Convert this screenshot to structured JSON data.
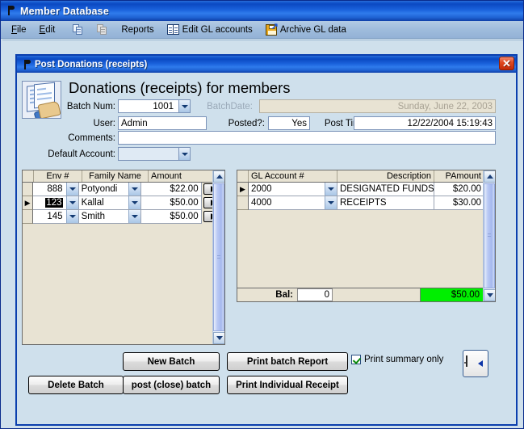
{
  "app": {
    "title": "Member Database",
    "menu": [
      {
        "label": "File",
        "accel": "F",
        "icon": "none"
      },
      {
        "label": "Edit",
        "accel": "E",
        "icon": "none"
      },
      {
        "label": "",
        "accel": "",
        "icon": "copy-icon"
      },
      {
        "label": "",
        "accel": "",
        "icon": "paste-icon"
      },
      {
        "label": "Reports",
        "accel": "",
        "icon": "none"
      },
      {
        "label": "Edit GL accounts",
        "accel": "",
        "icon": "book-icon"
      },
      {
        "label": "Archive GL data",
        "accel": "",
        "icon": "save-icon"
      }
    ]
  },
  "dialog": {
    "title": "Post Donations (receipts)",
    "close_label": "✕",
    "heading": "Donations (receipts) for members",
    "fields": {
      "batch_num_label": "Batch Num:",
      "batch_num_value": "1001",
      "batch_date_label": "BatchDate:",
      "batch_date_value": "Sunday, June 22, 2003",
      "user_label": "User:",
      "user_value": "Admin",
      "posted_label": "Posted?:",
      "posted_value": "Yes",
      "post_time_label": "Post Time",
      "post_time_value": "12/22/2004 15:19:43",
      "comments_label": "Comments:",
      "comments_value": "",
      "default_account_label": "Default Account:",
      "default_account_value": ""
    },
    "left_grid": {
      "columns": [
        "Env #",
        "Family Name",
        "Amount"
      ],
      "rows": [
        {
          "selector": "",
          "env": "888",
          "env_selected": false,
          "family": "Potyondi",
          "amount": "$22.00"
        },
        {
          "selector": "▶",
          "env": "123",
          "env_selected": true,
          "family": "Kallal",
          "amount": "$50.00"
        },
        {
          "selector": "",
          "env": "145",
          "env_selected": false,
          "family": "Smith",
          "amount": "$50.00"
        }
      ]
    },
    "right_grid": {
      "columns": [
        "GL Account #",
        "Description",
        "PAmount"
      ],
      "rows": [
        {
          "selector": "▶",
          "account": "2000",
          "description": "DESIGNATED FUNDS",
          "amount": "$20.00"
        },
        {
          "selector": "",
          "account": "4000",
          "description": "RECEIPTS",
          "amount": "$30.00"
        }
      ],
      "balance_label": "Bal:",
      "balance_value": "0",
      "total_value": "$50.00",
      "total_color": "#00ef00"
    },
    "buttons": {
      "new_batch": "New Batch",
      "delete_batch": "Delete Batch",
      "post_close_batch": "post (close) batch",
      "print_batch_report": "Print batch Report",
      "print_individual_receipt": "Print Individual Receipt",
      "exit_icon": "exit-door-icon"
    },
    "checkbox": {
      "label": "Print summary only",
      "checked": true
    }
  }
}
